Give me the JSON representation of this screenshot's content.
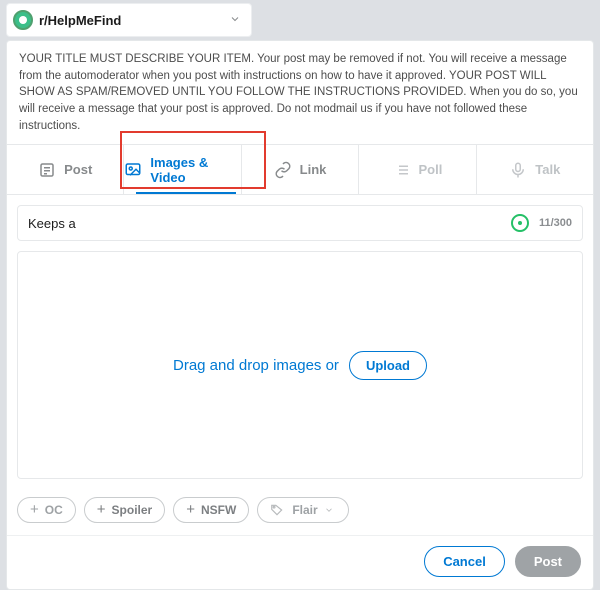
{
  "community": {
    "name": "r/HelpMeFind"
  },
  "rules_text": "YOUR TITLE MUST DESCRIBE YOUR ITEM. Your post may be removed if not. You will receive a message from the automoderator when you post with instructions on how to have it approved. YOUR POST WILL SHOW AS SPAM/REMOVED UNTIL YOU FOLLOW THE INSTRUCTIONS PROVIDED. When you do so, you will receive a message that your post is approved. Do not modmail us if you have not followed these instructions.",
  "tabs": {
    "post": "Post",
    "images_video": "Images & Video",
    "link": "Link",
    "poll": "Poll",
    "talk": "Talk"
  },
  "title_field": {
    "value": "Keeps a",
    "counter": "11/300"
  },
  "dropzone": {
    "text": "Drag and drop images or",
    "upload": "Upload"
  },
  "tags": {
    "oc": "OC",
    "spoiler": "Spoiler",
    "nsfw": "NSFW",
    "flair": "Flair"
  },
  "buttons": {
    "cancel": "Cancel",
    "post": "Post"
  }
}
